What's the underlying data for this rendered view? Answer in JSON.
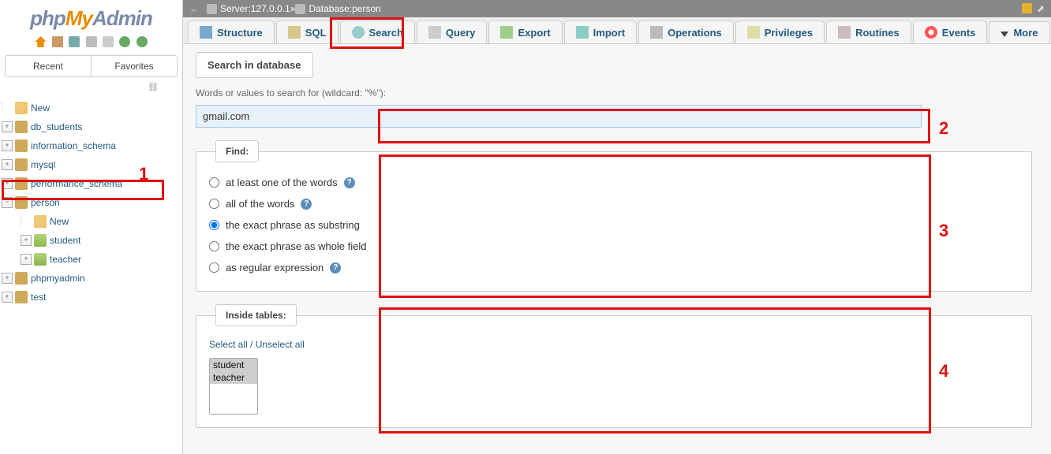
{
  "sidebar": {
    "tabs": {
      "recent": "Recent",
      "favorites": "Favorites"
    },
    "tree": {
      "new": "New",
      "db_students": "db_students",
      "information_schema": "information_schema",
      "mysql": "mysql",
      "performance_schema": "performance_schema",
      "person": "person",
      "person_children": {
        "new": "New",
        "student": "student",
        "teacher": "teacher"
      },
      "phpmyadmin": "phpmyadmin",
      "test": "test"
    }
  },
  "topbar": {
    "server_label": "Server: ",
    "server_value": "127.0.0.1",
    "sep": " » ",
    "db_label": "Database: ",
    "db_value": "person"
  },
  "tabs": {
    "structure": "Structure",
    "sql": "SQL",
    "search": "Search",
    "query": "Query",
    "export": "Export",
    "import": "Import",
    "operations": "Operations",
    "privileges": "Privileges",
    "routines": "Routines",
    "events": "Events",
    "more": "More"
  },
  "search": {
    "panel_title": "Search in database",
    "hint": "Words or values to search for (wildcard: \"%\"):",
    "value": "gmail.com",
    "find_legend": "Find:",
    "opt_atleast": "at least one of the words",
    "opt_all": "all of the words",
    "opt_exact_sub": "the exact phrase as substring",
    "opt_exact_whole": "the exact phrase as whole field",
    "opt_regex": "as regular expression",
    "inside_legend": "Inside tables:",
    "select_all": "Select all",
    "unselect_all": "Unselect all",
    "tables": [
      "student",
      "teacher"
    ]
  },
  "annotations": {
    "n1": "1",
    "n2": "2",
    "n3": "3",
    "n4": "4"
  }
}
